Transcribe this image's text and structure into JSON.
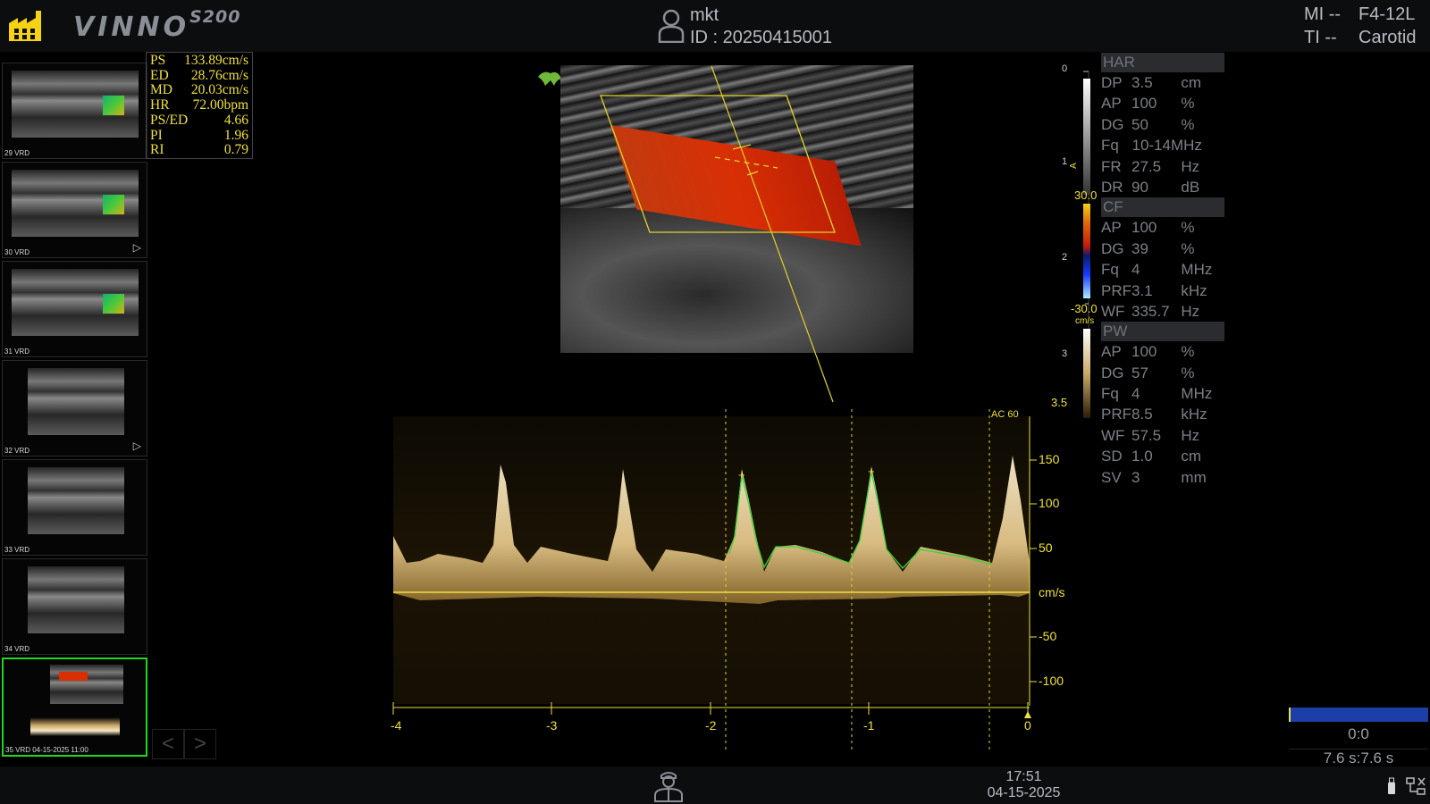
{
  "header": {
    "brand": "VINNO",
    "model": "S200",
    "patient_name": "mkt",
    "patient_id": "ID :  20250415001",
    "mi": "MI --",
    "ti": "TI --",
    "probe": "F4-12L",
    "preset": "Carotid"
  },
  "thumbnails": [
    {
      "caption": "29 VRD",
      "has_play": false,
      "active": false
    },
    {
      "caption": "30 VRD",
      "has_play": true,
      "active": false
    },
    {
      "caption": "31 VRD",
      "has_play": false,
      "active": false
    },
    {
      "caption": "32 VRD",
      "has_play": true,
      "active": false
    },
    {
      "caption": "33 VRD",
      "has_play": false,
      "active": false
    },
    {
      "caption": "34 VRD",
      "has_play": false,
      "active": false
    },
    {
      "caption": "35 VRD 04-15-2025 11:00",
      "has_play": false,
      "active": true
    }
  ],
  "thumb_nav": {
    "prev": "<",
    "next": ">"
  },
  "measurements": [
    {
      "label": "PS",
      "value": "133.89cm/s"
    },
    {
      "label": "ED",
      "value": "28.76cm/s"
    },
    {
      "label": "MD",
      "value": "20.03cm/s"
    },
    {
      "label": "HR",
      "value": "72.00bpm"
    },
    {
      "label": "PS/ED",
      "value": "4.66"
    },
    {
      "label": "PI",
      "value": "1.96"
    },
    {
      "label": "RI",
      "value": "0.79"
    }
  ],
  "depth_scale": {
    "labels": [
      "0",
      "1",
      "2",
      "3",
      "3.5"
    ],
    "marker": "A"
  },
  "color_scale": {
    "max": "30.0",
    "min": "-30.0",
    "unit": "cm/s"
  },
  "params": {
    "har": {
      "title": "HAR",
      "rows": [
        {
          "k": "DP",
          "v": "3.5",
          "u": "cm"
        },
        {
          "k": "AP",
          "v": "100",
          "u": "%"
        },
        {
          "k": "DG",
          "v": "50",
          "u": "%"
        },
        {
          "k": "Fq",
          "v": "10-14MHz",
          "u": ""
        },
        {
          "k": "FR",
          "v": "27.5",
          "u": "Hz"
        },
        {
          "k": "DR",
          "v": "90",
          "u": "dB"
        }
      ]
    },
    "cf": {
      "title": "CF",
      "rows": [
        {
          "k": "AP",
          "v": "100",
          "u": "%"
        },
        {
          "k": "DG",
          "v": "39",
          "u": "%"
        },
        {
          "k": "Fq",
          "v": "4",
          "u": "MHz"
        },
        {
          "k": "PRF",
          "v": "3.1",
          "u": "kHz"
        },
        {
          "k": "WF",
          "v": "335.7",
          "u": "Hz"
        }
      ]
    },
    "pw": {
      "title": "PW",
      "rows": [
        {
          "k": "AP",
          "v": "100",
          "u": "%"
        },
        {
          "k": "DG",
          "v": "57",
          "u": "%"
        },
        {
          "k": "Fq",
          "v": "4",
          "u": "MHz"
        },
        {
          "k": "PRF",
          "v": "8.5",
          "u": "kHz"
        },
        {
          "k": "WF",
          "v": "57.5",
          "u": "Hz"
        },
        {
          "k": "SD",
          "v": "1.0",
          "u": "cm"
        },
        {
          "k": "SV",
          "v": "3",
          "u": "mm"
        }
      ]
    }
  },
  "spectrum": {
    "ac_label": "AC 60",
    "velocity_labels": [
      "150",
      "100",
      "50",
      "cm/s",
      "-50",
      "-100"
    ],
    "time_labels": [
      "-4",
      "-3",
      "-2",
      "-1",
      "0"
    ]
  },
  "cine": {
    "counter": "0:0",
    "time": "7.6 s:7.6 s"
  },
  "footer": {
    "time": "17:51",
    "date": "04-15-2025"
  },
  "colors": {
    "accent_yellow": "#f0e03a",
    "active_green": "#1fd81f",
    "doppler_red": "#d92f05",
    "cine_blue": "#1b3ea8"
  },
  "icons": [
    "factory-logo-icon",
    "patient-icon",
    "doctor-icon",
    "usb-icon",
    "network-icon",
    "play-icon",
    "probe-indicator-icon"
  ]
}
